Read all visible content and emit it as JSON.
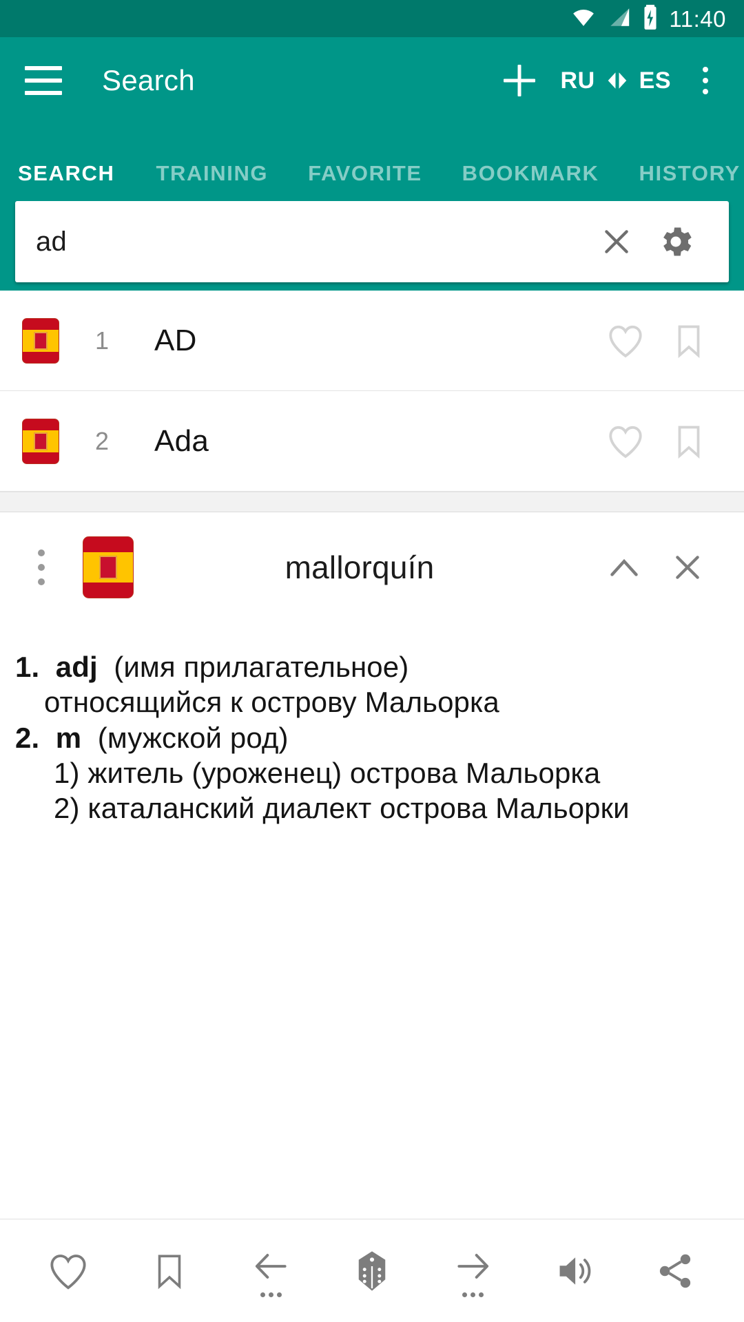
{
  "status_bar": {
    "time": "11:40",
    "icons": [
      "wifi-icon",
      "cellular-signal-icon",
      "battery-charging-icon"
    ]
  },
  "app_bar": {
    "menu_icon": "hamburger-menu-icon",
    "title": "Search",
    "add_icon": "plus-icon",
    "lang_from": "RU",
    "lang_swap_icon": "swap-arrows-icon",
    "lang_to": "ES",
    "overflow_icon": "vertical-dots-icon"
  },
  "tabs": [
    {
      "label": "SEARCH",
      "active": true
    },
    {
      "label": "TRAINING",
      "active": false
    },
    {
      "label": "FAVORITE",
      "active": false
    },
    {
      "label": "BOOKMARK",
      "active": false
    },
    {
      "label": "HISTORY",
      "active": false
    }
  ],
  "search": {
    "value": "ad",
    "placeholder": "",
    "clear_icon": "close-x-icon",
    "settings_icon": "gear-icon"
  },
  "results": [
    {
      "flag": "spain-flag-icon",
      "index": "1",
      "word": "AD",
      "favorite_icon": "heart-outline-icon",
      "bookmark_icon": "bookmark-outline-icon"
    },
    {
      "flag": "spain-flag-icon",
      "index": "2",
      "word": "Ada",
      "favorite_icon": "heart-outline-icon",
      "bookmark_icon": "bookmark-outline-icon"
    }
  ],
  "detail": {
    "menu_icon": "vertical-dots-icon",
    "flag": "spain-flag-icon",
    "title": "mallorquín",
    "collapse_icon": "chevron-up-icon",
    "close_icon": "close-x-icon",
    "definitions": [
      {
        "num": "1.",
        "pos": "adj",
        "gloss": "(имя прилагательное)"
      },
      {
        "text": "относящийся к острову Мальорка"
      },
      {
        "num": "2.",
        "pos": "m",
        "gloss": "(мужской род)"
      },
      {
        "text": "1) житель (уроженец) острова Мальорка"
      },
      {
        "text": "2) каталанский диалект острова Мальорки"
      }
    ]
  },
  "bottom_bar": {
    "buttons": [
      {
        "icon": "heart-outline-icon"
      },
      {
        "icon": "bookmark-outline-icon"
      },
      {
        "icon": "arrow-left-icon"
      },
      {
        "icon": "dice-icon"
      },
      {
        "icon": "arrow-right-icon"
      },
      {
        "icon": "speaker-volume-icon"
      },
      {
        "icon": "share-icon"
      }
    ]
  },
  "colors": {
    "status_bar": "#00796b",
    "app_bar": "#009688",
    "accent": "#009688",
    "icon_grey": "#7d7d7d",
    "text_primary": "#141414"
  }
}
